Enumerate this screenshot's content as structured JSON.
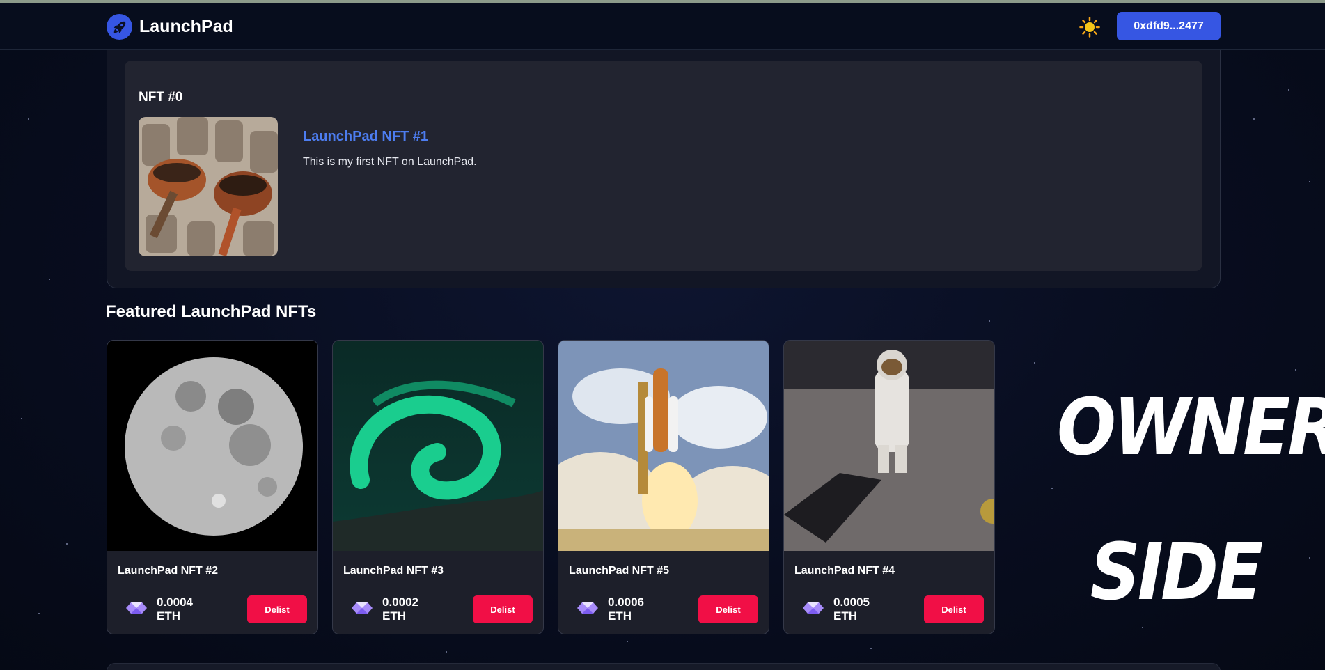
{
  "header": {
    "logo_text": "LaunchPad",
    "theme_icon": "sun-icon",
    "wallet_label": "0xdfd9...2477"
  },
  "owned": {
    "heading": "NFT #0",
    "title": "LaunchPad NFT #1",
    "description": "This is my first NFT on LaunchPad.",
    "image": "coffee-pots-image"
  },
  "featured": {
    "title": "Featured LaunchPad NFTs",
    "cards": [
      {
        "name": "LaunchPad NFT #2",
        "price": "0.0004",
        "unit": "ETH",
        "button": "Delist",
        "image": "moon-image"
      },
      {
        "name": "LaunchPad NFT #3",
        "price": "0.0002",
        "unit": "ETH",
        "button": "Delist",
        "image": "aurora-image"
      },
      {
        "name": "LaunchPad NFT #5",
        "price": "0.0006",
        "unit": "ETH",
        "button": "Delist",
        "image": "shuttle-launch-image"
      },
      {
        "name": "LaunchPad NFT #4",
        "price": "0.0005",
        "unit": "ETH",
        "button": "Delist",
        "image": "astronaut-image"
      }
    ]
  },
  "overlay": {
    "line1": "OWNER",
    "line2": "SIDE"
  },
  "colors": {
    "accent": "#3656e3",
    "link": "#4d7df0",
    "delist": "#f10f46",
    "background": "#080d1f"
  }
}
